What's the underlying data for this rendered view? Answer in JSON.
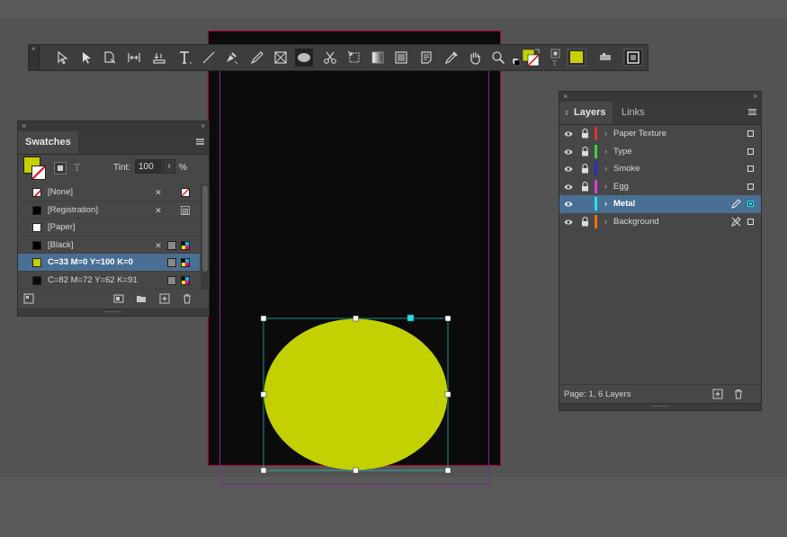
{
  "swatches": {
    "tab_label": "Swatches",
    "tint_label": "Tint:",
    "tint_value": "100",
    "tint_unit": "%",
    "items": [
      {
        "name": "[None]",
        "color": "#ffffff"
      },
      {
        "name": "[Registration]",
        "color": "#000000"
      },
      {
        "name": "[Paper]",
        "color": "#ffffff"
      },
      {
        "name": "[Black]",
        "color": "#000000"
      },
      {
        "name": "C=33 M=0 Y=100 K=0",
        "color": "#c4d100"
      },
      {
        "name": "C=82 M=72 Y=62 K=91",
        "color": "#0a0a0a"
      }
    ]
  },
  "layers": {
    "tabs": [
      "Layers",
      "Links"
    ],
    "items": [
      {
        "name": "Paper Texture",
        "color": "#e0302c"
      },
      {
        "name": "Type",
        "color": "#41d141"
      },
      {
        "name": "Smoke",
        "color": "#2a2ad0"
      },
      {
        "name": "Egg",
        "color": "#d541d5"
      },
      {
        "name": "Metal",
        "color": "#26e3e3"
      },
      {
        "name": "Background",
        "color": "#e8701e"
      }
    ],
    "status": "Page: 1, 6 Layers"
  },
  "document": {
    "egg_fill": "#c4d100",
    "page_bg": "#0b0b0b",
    "bleed_color": "#b2003a",
    "margin_color": "#7d2f8a"
  },
  "toolbar": {
    "tools": [
      "direct-selection-icon",
      "selection-icon",
      "page-tool-icon",
      "gap-tool-icon",
      "content-collector-icon",
      "type-icon",
      "line-icon",
      "pen-icon",
      "pencil-icon",
      "rectangle-frame-icon",
      "ellipse-icon",
      "scissors-icon",
      "free-transform-icon",
      "gradient-swatch-icon",
      "gradient-feather-icon",
      "note-icon",
      "eyedropper-icon",
      "hand-icon",
      "zoom-icon"
    ]
  }
}
